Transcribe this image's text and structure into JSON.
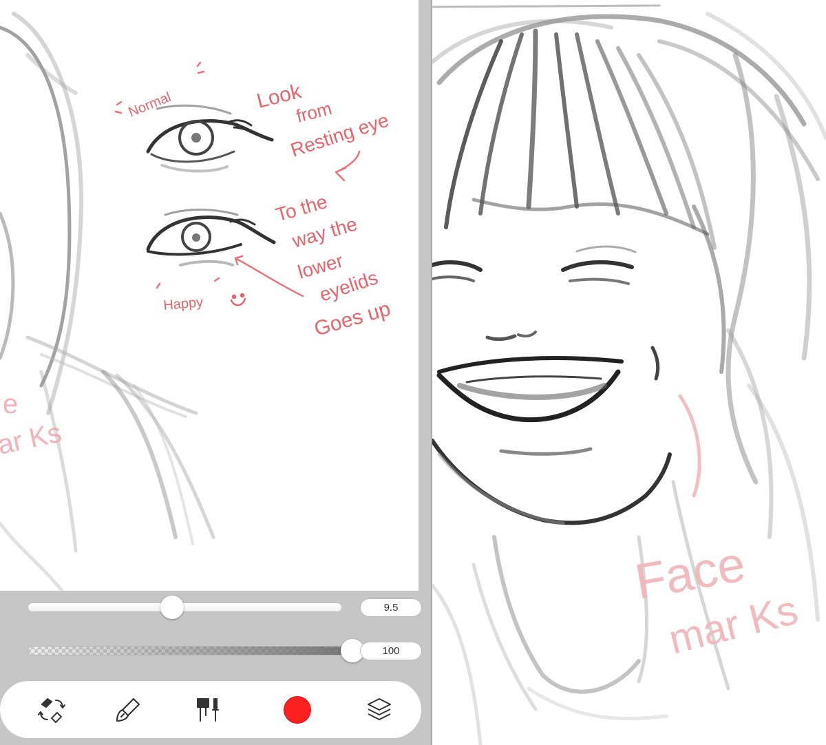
{
  "annotations": {
    "normal": "Normal",
    "look": "Look",
    "from": "from",
    "resting": "Resting eye",
    "to_the": "To the",
    "way_the": "way the",
    "lower": "lower",
    "eyelids": "eyelids",
    "goes_up": "Goes up",
    "happy": "Happy",
    "face_partial_1": "e",
    "face_partial_2": "ar Ks",
    "face": "Face",
    "marks": "mar Ks"
  },
  "controls": {
    "brush_size": {
      "value": "9.5",
      "fraction": 0.46
    },
    "opacity": {
      "value": "100",
      "fraction": 1.0
    }
  },
  "toolbar": {
    "tools": [
      {
        "name": "swap-brush-eraser",
        "icon": "brush-eraser-swap-icon"
      },
      {
        "name": "brush",
        "icon": "brush-icon"
      },
      {
        "name": "brush-library",
        "icon": "brush-library-icon"
      },
      {
        "name": "color",
        "icon": "color-swatch",
        "color": "#ff2020"
      },
      {
        "name": "layers",
        "icon": "layers-icon"
      }
    ]
  },
  "colors": {
    "annotation": "#e8646a",
    "annotation_faded": "#f0b4b6",
    "sketch": "#3a3a3a",
    "background": "#c6c6c6"
  }
}
